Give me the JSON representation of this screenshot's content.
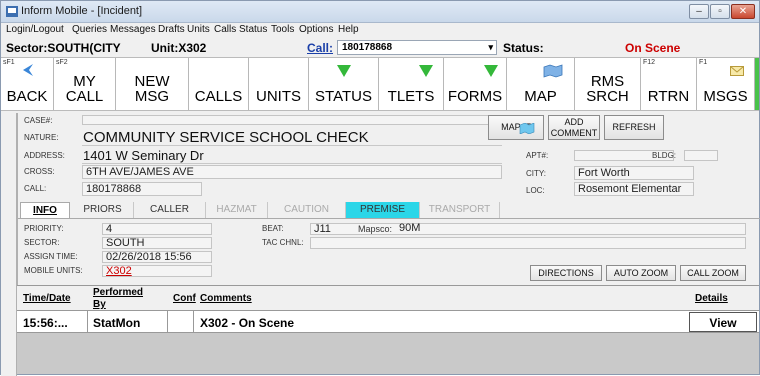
{
  "window": {
    "title": "Inform Mobile - [Incident]"
  },
  "menu": [
    "Login/Logout",
    "Queries",
    "Messages",
    "Drafts",
    "Units",
    "Calls",
    "Status",
    "Tools",
    "Options",
    "Help"
  ],
  "status_bar": {
    "sector_text": "Sector:SOUTH(CITY",
    "unit_text": "Unit:X302",
    "call_label": "Call:",
    "call_value": "180178868",
    "status_label": "Status:",
    "status_value": "On Scene",
    "status_color": "#cc0000"
  },
  "toolbar": {
    "back": {
      "fkey": "sF1",
      "label": "BACK"
    },
    "my_call": {
      "fkey": "sF2",
      "line1": "MY",
      "line2": "CALL"
    },
    "new_msg": {
      "line1": "NEW",
      "line2": "MSG"
    },
    "calls": {
      "label": "CALLS"
    },
    "units": {
      "label": "UNITS"
    },
    "status": {
      "label": "STATUS"
    },
    "tlets": {
      "label": "TLETS"
    },
    "forms": {
      "label": "FORMS"
    },
    "map": {
      "label": "MAP"
    },
    "rms_srch": {
      "line1": "RMS",
      "line2": "SRCH"
    },
    "rtrn": {
      "fkey": "F12",
      "label": "RTRN"
    },
    "msgs": {
      "fkey": "F1",
      "label": "MSGS"
    }
  },
  "incident": {
    "case_label": "CASE#:",
    "case_value": "",
    "nature_label": "NATURE:",
    "nature_value": "COMMUNITY SERVICE SCHOOL CHECK",
    "address_label": "ADDRESS:",
    "address_value": "1401 W Seminary Dr",
    "cross_label": "CROSS:",
    "cross_value": "6TH AVE/JAMES AVE",
    "call_label": "CALL:",
    "call_value": "180178868",
    "apt_label": "APT#:",
    "apt_value": "",
    "bldg_label": "BLDG:",
    "bldg_value": "",
    "city_label": "CITY:",
    "city_value": "Fort Worth",
    "loc_label": "LOC:",
    "loc_value": "Rosemont Elementar"
  },
  "buttons": {
    "map_it": "MAP IT",
    "add_comment_line1": "ADD",
    "add_comment_line2": "COMMENT",
    "refresh": "REFRESH",
    "directions": "DIRECTIONS",
    "auto_zoom": "AUTO ZOOM",
    "call_zoom": "CALL ZOOM"
  },
  "tabs": [
    "INFO",
    "PRIORS",
    "CALLER",
    "HAZMAT",
    "CAUTION",
    "PREMISE",
    "TRANSPORT"
  ],
  "info": {
    "priority_label": "PRIORITY:",
    "priority_value": "4",
    "sector_label": "SECTOR:",
    "sector_value": "SOUTH",
    "assign_label": "ASSIGN TIME:",
    "assign_value": "02/26/2018 15:56",
    "mobile_label": "MOBILE UNITS:",
    "mobile_value": "X302",
    "beat_label": "BEAT:",
    "beat_value": "J11",
    "mapsco_label": "Mapsco:",
    "mapsco_value": "90M",
    "tac_label": "TAC CHNL:",
    "tac_value": ""
  },
  "grid": {
    "headers": {
      "time_date": "Time/Date",
      "performed_by_1": "Performed",
      "performed_by_2": "By",
      "conf": "Conf",
      "comments": "Comments",
      "details": "Details"
    },
    "rows": [
      {
        "time": "15:56:...",
        "by": "StatMon",
        "conf": "",
        "comment": "X302 - On Scene",
        "details": "View"
      }
    ]
  }
}
